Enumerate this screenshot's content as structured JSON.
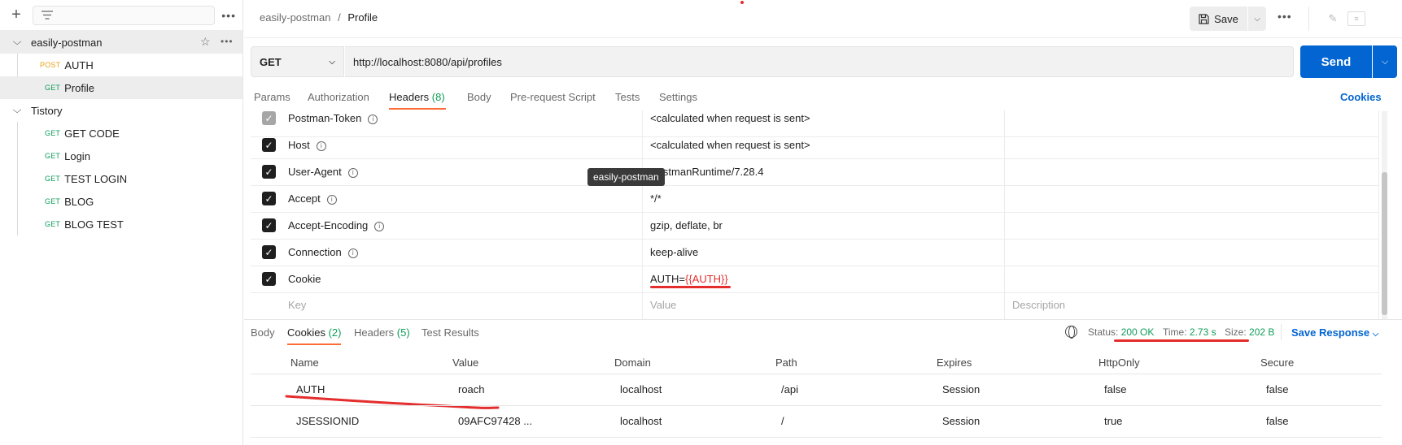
{
  "sidebar": {
    "collections": [
      {
        "name": "easily-postman",
        "requests": [
          {
            "method": "POST",
            "name": "AUTH"
          },
          {
            "method": "GET",
            "name": "Profile"
          }
        ]
      },
      {
        "name": "Tistory",
        "requests": [
          {
            "method": "GET",
            "name": "GET CODE"
          },
          {
            "method": "GET",
            "name": "Login"
          },
          {
            "method": "GET",
            "name": "TEST LOGIN"
          },
          {
            "method": "GET",
            "name": "BLOG"
          },
          {
            "method": "GET",
            "name": "BLOG TEST"
          }
        ]
      }
    ]
  },
  "header": {
    "breadcrumb_parent": "easily-postman",
    "breadcrumb_sep": "/",
    "breadcrumb_current": "Profile",
    "save_label": "Save"
  },
  "request": {
    "method": "GET",
    "url": "http://localhost:8080/api/profiles",
    "send_label": "Send",
    "tabs": [
      {
        "label": "Params"
      },
      {
        "label": "Authorization"
      },
      {
        "label": "Headers",
        "count": "(8)"
      },
      {
        "label": "Body"
      },
      {
        "label": "Pre-request Script"
      },
      {
        "label": "Tests"
      },
      {
        "label": "Settings"
      }
    ],
    "cookies_link": "Cookies"
  },
  "headers_table": {
    "rows": [
      {
        "key": "Postman-Token",
        "value": "<calculated when request is sent>"
      },
      {
        "key": "Host",
        "value": "<calculated when request is sent>"
      },
      {
        "key": "User-Agent",
        "value": "PostmanRuntime/7.28.4"
      },
      {
        "key": "Accept",
        "value": "*/*"
      },
      {
        "key": "Accept-Encoding",
        "value": "gzip, deflate, br"
      },
      {
        "key": "Connection",
        "value": "keep-alive"
      },
      {
        "key": "Cookie",
        "value_prefix": "AUTH=",
        "value_var": "{{AUTH}}"
      }
    ],
    "placeholder": {
      "key": "Key",
      "value": "Value",
      "description": "Description"
    },
    "tooltip": "easily-postman"
  },
  "response": {
    "tabs": [
      {
        "label": "Body"
      },
      {
        "label": "Cookies",
        "count": "(2)"
      },
      {
        "label": "Headers",
        "count": "(5)"
      },
      {
        "label": "Test Results"
      }
    ],
    "status_label": "Status:",
    "status_value": "200 OK",
    "time_label": "Time:",
    "time_value": "2.73 s",
    "size_label": "Size:",
    "size_value": "202 B",
    "save_response": "Save Response",
    "cookies": {
      "columns": [
        "Name",
        "Value",
        "Domain",
        "Path",
        "Expires",
        "HttpOnly",
        "Secure"
      ],
      "rows": [
        [
          "AUTH",
          "roach",
          "localhost",
          "/api",
          "Session",
          "false",
          "false"
        ],
        [
          "JSESSIONID",
          "09AFC97428 ...",
          "localhost",
          "/",
          "Session",
          "true",
          "false"
        ]
      ]
    }
  }
}
